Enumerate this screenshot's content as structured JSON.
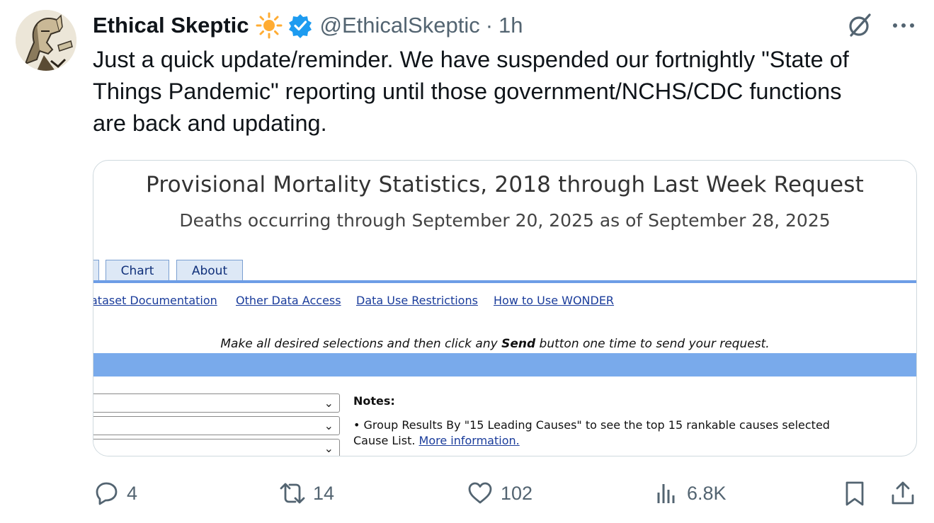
{
  "author": {
    "display_name": "Ethical Skeptic",
    "emoji_icon": "sun-icon",
    "verified_icon": "verified-badge-icon",
    "handle": "@EthicalSkeptic",
    "separator": "·",
    "time": "1h"
  },
  "tweet": {
    "text": "Just a quick update/reminder. We have suspended our fortnightly \"State of\nThings Pandemic\" reporting until those government/NCHS/CDC functions\nare back and updating."
  },
  "media": {
    "title": "Provisional Mortality Statistics, 2018 through Last Week Request",
    "subtitle": "Deaths occurring through September 20, 2025 as of September 28, 2025",
    "tabs": [
      "Chart",
      "About"
    ],
    "links": [
      "ataset Documentation",
      "Other Data Access",
      "Data Use Restrictions",
      "How to Use WONDER"
    ],
    "instruction_before": "Make all desired selections and then click any ",
    "instruction_bold": "Send",
    "instruction_after": " button one time to send your request.",
    "notes_title": "Notes:",
    "note_line1": "• Group Results By \"15 Leading Causes\" to see the top 15 rankable causes selected",
    "note_line2_prefix": "Cause List. ",
    "note_line2_link": "More information."
  },
  "actions": {
    "replies": "4",
    "reposts": "14",
    "likes": "102",
    "views": "6.8K"
  },
  "colors": {
    "text_primary": "#0f1419",
    "text_secondary": "#536471",
    "verified_blue": "#1d9bf0",
    "card_border": "#cfd9de",
    "band_blue": "#79aaeb"
  }
}
